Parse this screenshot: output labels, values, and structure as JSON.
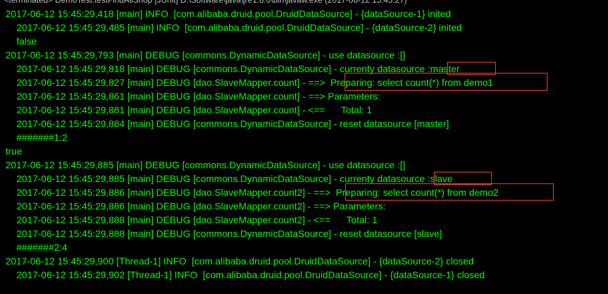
{
  "console": {
    "header_text": "<terminated> DemoTest.testFindAllShop [JUnit] D:\\Software\\java\\jre1.8.0\\bin\\javaw.exe (2017-06-12 15:45:27)",
    "lines": [
      {
        "text": "2017-06-12 15:45:29,418 [main] INFO  [com.alibaba.druid.pool.DruidDataSource] - {dataSource-1} inited",
        "indent": false
      },
      {
        "text": "2017-06-12 15:45:29,485 [main] INFO  [com.alibaba.druid.pool.DruidDataSource] - {dataSource-2} inited",
        "indent": true
      },
      {
        "text": "false",
        "indent": true
      },
      {
        "text": "2017-06-12 15:45:29,793 [main] DEBUG [commons.DynamicDataSource] - use datasource :[]",
        "indent": false
      },
      {
        "text": "2017-06-12 15:45:29,818 [main] DEBUG [commons.DynamicDataSource] - currenty datasource :master",
        "indent": true
      },
      {
        "text": "2017-06-12 15:45:29,827 [main] DEBUG [dao.SlaveMapper.count] - ==>  Preparing: select count(*) from demo1 ",
        "indent": true
      },
      {
        "text": "2017-06-12 15:45:29,861 [main] DEBUG [dao.SlaveMapper.count] - ==> Parameters: ",
        "indent": true
      },
      {
        "text": "2017-06-12 15:45:29,881 [main] DEBUG [dao.SlaveMapper.count] - <==      Total: 1",
        "indent": true
      },
      {
        "text": "2017-06-12 15:45:29,884 [main] DEBUG [commons.DynamicDataSource] - reset datasource [master]",
        "indent": true
      },
      {
        "text": "#######1:2",
        "indent": true
      },
      {
        "text": "true",
        "indent": false
      },
      {
        "text": "2017-06-12 15:45:29,885 [main] DEBUG [commons.DynamicDataSource] - use datasource :[]",
        "indent": false
      },
      {
        "text": "2017-06-12 15:45:29,885 [main] DEBUG [commons.DynamicDataSource] - currenty datasource :slave",
        "indent": true
      },
      {
        "text": "2017-06-12 15:45:29,886 [main] DEBUG [dao.SlaveMapper.count2] - ==>  Preparing: select count(*) from demo2 ",
        "indent": true
      },
      {
        "text": "2017-06-12 15:45:29,886 [main] DEBUG [dao.SlaveMapper.count2] - ==> Parameters: ",
        "indent": true
      },
      {
        "text": "2017-06-12 15:45:29,888 [main] DEBUG [dao.SlaveMapper.count2] - <==      Total: 1",
        "indent": true
      },
      {
        "text": "2017-06-12 15:45:29,888 [main] DEBUG [commons.DynamicDataSource] - reset datasource [slave]",
        "indent": true
      },
      {
        "text": "#######2:4",
        "indent": true
      },
      {
        "text": "2017-06-12 15:45:29,900 [Thread-1] INFO  [com.alibaba.druid.pool.DruidDataSource] - {dataSource-2} closed",
        "indent": false
      },
      {
        "text": "2017-06-12 15:45:29,902 [Thread-1] INFO  [com.alibaba.druid.pool.DruidDataSource] - {dataSource-1} closed",
        "indent": true
      }
    ]
  },
  "colors": {
    "background": "#000000",
    "text": "#00ff00",
    "highlight_box": "#ff3b3b"
  }
}
